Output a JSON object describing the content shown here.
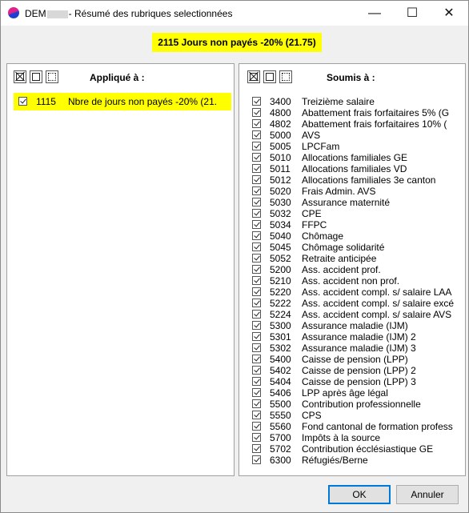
{
  "window": {
    "title_prefix": "DEM",
    "title_suffix": "- Résumé des rubriques selectionnées",
    "minimize": "—",
    "maximize": "☐",
    "close": "✕"
  },
  "headline": "2115 Jours non payés -20% (21.75)",
  "applied": {
    "title": "Appliqué à :",
    "items": [
      {
        "code": "1115",
        "label": "Nbre de jours non payés -20% (21."
      }
    ]
  },
  "subject": {
    "title": "Soumis à :",
    "items": [
      {
        "code": "3400",
        "label": "Treizième salaire"
      },
      {
        "code": "4800",
        "label": "Abattement frais forfaitaires 5% (G"
      },
      {
        "code": "4802",
        "label": "Abattement frais forfaitaires 10% ("
      },
      {
        "code": "5000",
        "label": "AVS"
      },
      {
        "code": "5005",
        "label": "LPCFam"
      },
      {
        "code": "5010",
        "label": "Allocations familiales GE"
      },
      {
        "code": "5011",
        "label": "Allocations familiales VD"
      },
      {
        "code": "5012",
        "label": "Allocations familiales 3e canton"
      },
      {
        "code": "5020",
        "label": "Frais Admin. AVS"
      },
      {
        "code": "5030",
        "label": "Assurance maternité"
      },
      {
        "code": "5032",
        "label": "CPE"
      },
      {
        "code": "5034",
        "label": "FFPC"
      },
      {
        "code": "5040",
        "label": "Chômage"
      },
      {
        "code": "5045",
        "label": "Chômage solidarité"
      },
      {
        "code": "5052",
        "label": "Retraite anticipée"
      },
      {
        "code": "5200",
        "label": "Ass. accident prof."
      },
      {
        "code": "5210",
        "label": "Ass. accident non prof."
      },
      {
        "code": "5220",
        "label": "Ass. accident compl. s/ salaire LAA"
      },
      {
        "code": "5222",
        "label": "Ass. accident compl. s/ salaire excé"
      },
      {
        "code": "5224",
        "label": "Ass. accident compl. s/ salaire AVS"
      },
      {
        "code": "5300",
        "label": "Assurance maladie (IJM)"
      },
      {
        "code": "5301",
        "label": "Assurance maladie (IJM) 2"
      },
      {
        "code": "5302",
        "label": "Assurance maladie (IJM) 3"
      },
      {
        "code": "5400",
        "label": "Caisse de pension (LPP)"
      },
      {
        "code": "5402",
        "label": "Caisse de pension (LPP) 2"
      },
      {
        "code": "5404",
        "label": "Caisse de pension (LPP) 3"
      },
      {
        "code": "5406",
        "label": "LPP après âge légal"
      },
      {
        "code": "5500",
        "label": "Contribution professionnelle"
      },
      {
        "code": "5550",
        "label": "CPS"
      },
      {
        "code": "5560",
        "label": "Fond cantonal de formation profess"
      },
      {
        "code": "5700",
        "label": "Impôts à la source"
      },
      {
        "code": "5702",
        "label": "Contribution écclésiastique GE"
      },
      {
        "code": "6300",
        "label": "Réfugiés/Berne"
      }
    ]
  },
  "buttons": {
    "ok": "OK",
    "cancel": "Annuler"
  },
  "colors": {
    "highlight": "#ffff00",
    "accent": "#0078d7"
  }
}
